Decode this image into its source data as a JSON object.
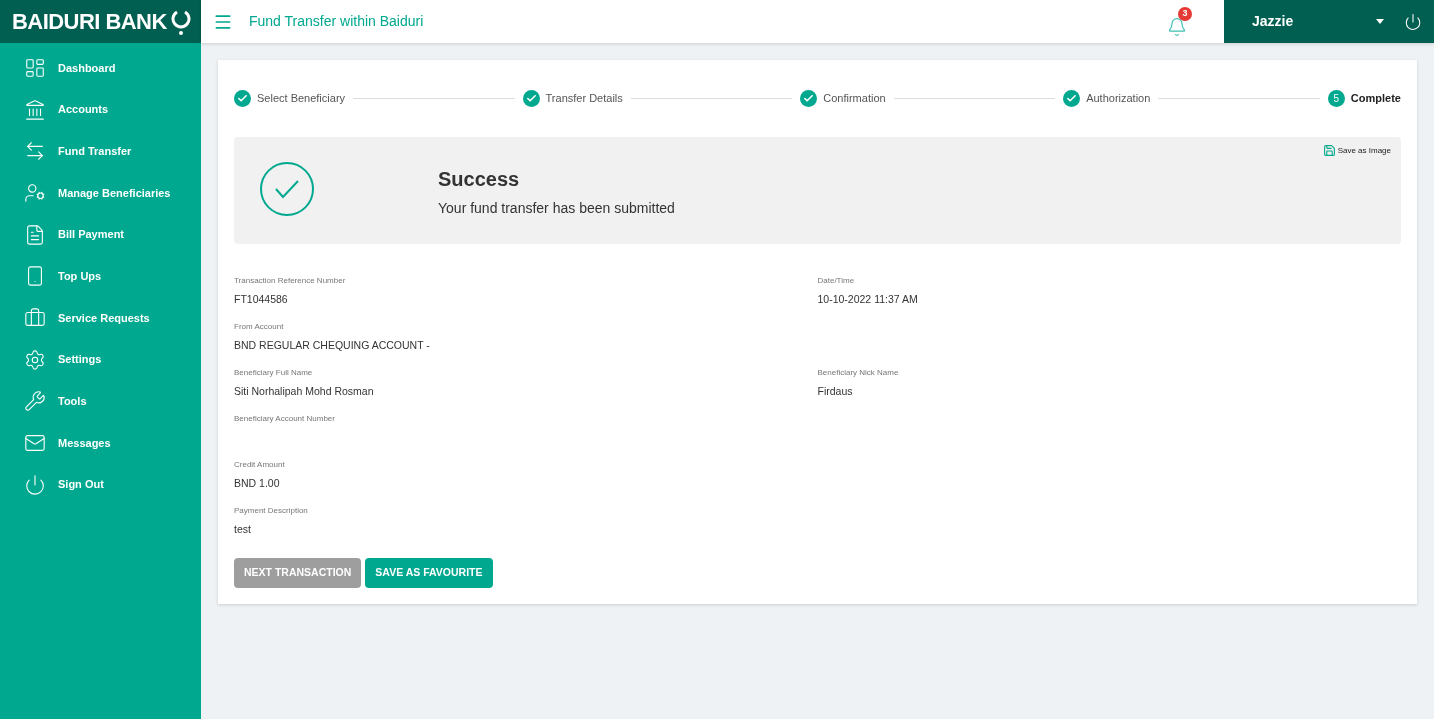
{
  "brand": {
    "name": "BAIDURI BANK"
  },
  "header": {
    "title": "Fund Transfer within Baiduri",
    "notification_count": "3",
    "user": "Jazzie"
  },
  "sidebar": {
    "items": [
      {
        "label": "Dashboard",
        "kind": "dashboard"
      },
      {
        "label": "Accounts",
        "kind": "accounts"
      },
      {
        "label": "Fund Transfer",
        "kind": "transfer"
      },
      {
        "label": "Manage Beneficiaries",
        "kind": "beneficiaries"
      },
      {
        "label": "Bill Payment",
        "kind": "bill"
      },
      {
        "label": "Top Ups",
        "kind": "topup"
      },
      {
        "label": "Service Requests",
        "kind": "service"
      },
      {
        "label": "Settings",
        "kind": "settings"
      },
      {
        "label": "Tools",
        "kind": "tools"
      },
      {
        "label": "Messages",
        "kind": "messages"
      },
      {
        "label": "Sign Out",
        "kind": "signout"
      }
    ]
  },
  "steps": [
    {
      "label": "Select Beneficiary",
      "done": true
    },
    {
      "label": "Transfer Details",
      "done": true
    },
    {
      "label": "Confirmation",
      "done": true
    },
    {
      "label": "Authorization",
      "done": true
    },
    {
      "label": "Complete",
      "done": false,
      "number": "5"
    }
  ],
  "result": {
    "title": "Success",
    "message": "Your fund transfer has been submitted",
    "save_link": "Save as Image"
  },
  "details": [
    [
      {
        "label": "Transaction Reference Number",
        "value": "FT1044586"
      },
      {
        "label": "Date/Time",
        "value": "10-10-2022 11:37 AM"
      }
    ],
    [
      {
        "label": "From Account",
        "value": "BND REGULAR CHEQUING ACCOUNT -"
      }
    ],
    [
      {
        "label": "Beneficiary Full Name",
        "value": "Siti Norhalipah Mohd Rosman"
      },
      {
        "label": "Beneficiary Nick Name",
        "value": "Firdaus"
      }
    ],
    [
      {
        "label": "Beneficiary Account Number"
      }
    ],
    [
      {
        "label": "Credit Amount",
        "value": "BND 1.00"
      }
    ],
    [
      {
        "label": "Payment Description",
        "value": "test"
      }
    ]
  ],
  "buttons": [
    {
      "label": "NEXT TRANSACTION",
      "kind": "secondary"
    },
    {
      "label": "SAVE AS FAVOURITE",
      "kind": "primary"
    }
  ]
}
